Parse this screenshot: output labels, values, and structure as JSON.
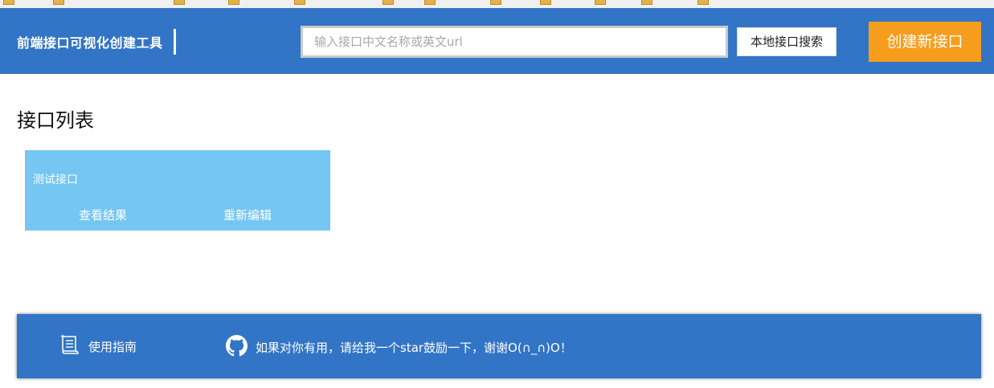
{
  "header": {
    "title": "前端接口可视化创建工具",
    "search_placeholder": "输入接口中文名称或英文url",
    "local_search_label": "本地接口搜索",
    "create_label": "创建新接口",
    "colors": {
      "bar": "#3275c6",
      "create_button": "#f79d1e"
    }
  },
  "main": {
    "section_title": "接口列表",
    "cards": [
      {
        "name": "测试接口",
        "view_label": "查看结果",
        "edit_label": "重新编辑",
        "color": "#75c6f2"
      }
    ]
  },
  "footer": {
    "guide_label": "使用指南",
    "guide_icon": "scroll-icon",
    "star_text": "如果对你有用，请给我一个star鼓励一下，谢谢O(∩_∩)O！",
    "star_icon": "github-icon"
  }
}
